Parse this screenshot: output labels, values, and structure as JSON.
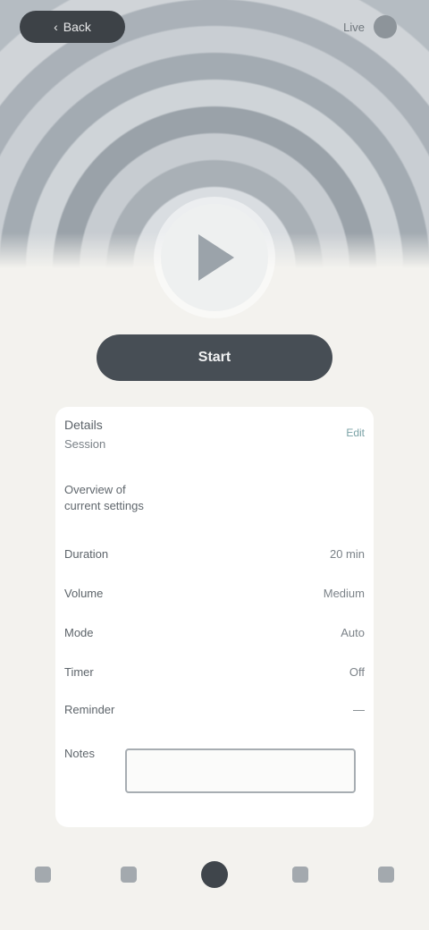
{
  "header": {
    "back_label": "Back",
    "status_text": "Live"
  },
  "hero": {
    "play_icon": "play-icon"
  },
  "cta": {
    "label": "Start"
  },
  "card": {
    "title": "Details",
    "subtitle": "Session",
    "link": "Edit",
    "description": "Overview of current settings",
    "rows": [
      {
        "label": "Duration",
        "value": "20 min"
      },
      {
        "label": "Volume",
        "value": "Medium"
      },
      {
        "label": "Mode",
        "value": "Auto"
      },
      {
        "label": "Timer",
        "value": "Off"
      },
      {
        "label": "Reminder",
        "value": "—"
      }
    ],
    "input_label": "Notes",
    "input_value": "",
    "input_placeholder": ""
  },
  "tabs": [
    {
      "label": "",
      "icon": "home-icon"
    },
    {
      "label": "",
      "icon": "search-icon"
    },
    {
      "label": "",
      "icon": "player-icon"
    },
    {
      "label": "",
      "icon": "library-icon"
    },
    {
      "label": "",
      "icon": "profile-icon"
    }
  ]
}
